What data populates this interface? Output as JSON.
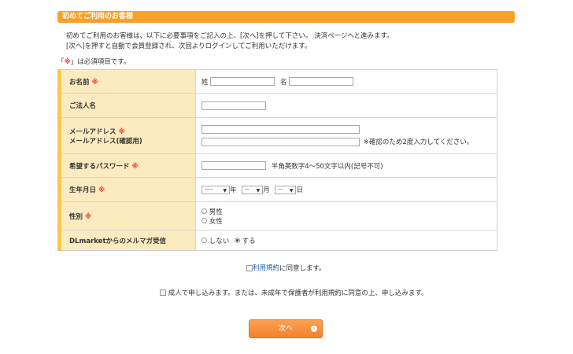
{
  "header": {
    "title": "初めてご利用のお客様"
  },
  "intro": {
    "line1": "初めてご利用のお客様は、以下に必要事項をご記入の上、[次へ]を押して下さい。 決済ページへと進みます。",
    "line2": "[次へ]を押すと自動で会員登録され、次回よりログインしてご利用いただけます。"
  },
  "required_note": {
    "open": "「",
    "mark": "※",
    "rest": "」は必須項目です。"
  },
  "form": {
    "name": {
      "label": "お名前",
      "mark": "※",
      "last_label": "姓",
      "first_label": "名",
      "last_value": "",
      "first_value": ""
    },
    "company": {
      "label": "ご法人名",
      "value": ""
    },
    "email": {
      "label1": "メールアドレス",
      "label2": "メールアドレス(確認用)",
      "mark": "※",
      "note": "※確認のため2度入力してください。"
    },
    "password": {
      "label": "希望するパスワード",
      "mark": "※",
      "note": "半角英数字4〜50文字以内(記号不可)"
    },
    "birthday": {
      "label": "生年月日",
      "mark": "※",
      "year_value": "----",
      "year_unit": "年",
      "month_value": "--",
      "month_unit": "月",
      "day_value": "--",
      "day_unit": "日"
    },
    "gender": {
      "label": "性別",
      "mark": "※",
      "male": "男性",
      "female": "女性"
    },
    "mailmag": {
      "label": "DLmarketからのメルマガ受信",
      "no": "しない",
      "yes": "する"
    }
  },
  "terms": {
    "link": "利用規約",
    "text": "に同意します。"
  },
  "adult": {
    "text": "成人で申し込みます。または、未成年で保護者が利用規約に同意の上、申し込みます。"
  },
  "next_button": {
    "label": "次へ",
    "icon": "chevron-right-icon"
  }
}
